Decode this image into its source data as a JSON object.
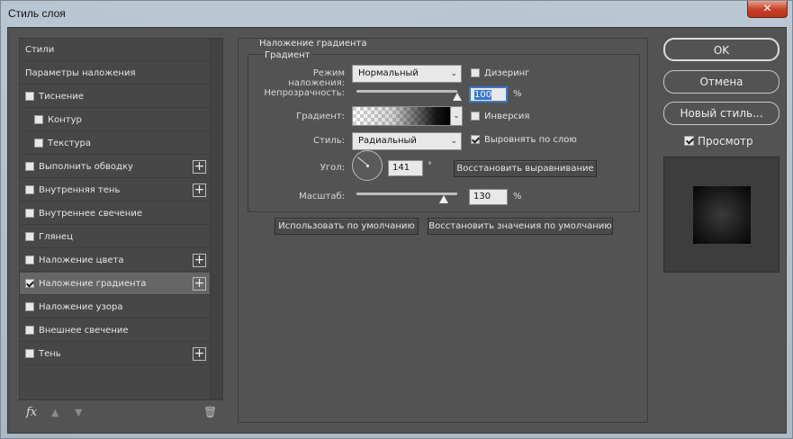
{
  "window": {
    "title": "Стиль слоя",
    "close_label": "✕"
  },
  "sidebar": {
    "items": [
      {
        "label": "Стили",
        "checkbox": false,
        "checked": false,
        "plus": false,
        "indent": 0,
        "selected": false
      },
      {
        "label": "Параметры наложения",
        "checkbox": false,
        "checked": false,
        "plus": false,
        "indent": 0,
        "selected": false
      },
      {
        "label": "Тиснение",
        "checkbox": true,
        "checked": false,
        "plus": false,
        "indent": 0,
        "selected": false
      },
      {
        "label": "Контур",
        "checkbox": true,
        "checked": false,
        "plus": false,
        "indent": 1,
        "selected": false
      },
      {
        "label": "Текстура",
        "checkbox": true,
        "checked": false,
        "plus": false,
        "indent": 1,
        "selected": false
      },
      {
        "label": "Выполнить обводку",
        "checkbox": true,
        "checked": false,
        "plus": true,
        "indent": 0,
        "selected": false
      },
      {
        "label": "Внутренняя тень",
        "checkbox": true,
        "checked": false,
        "plus": true,
        "indent": 0,
        "selected": false
      },
      {
        "label": "Внутреннее свечение",
        "checkbox": true,
        "checked": false,
        "plus": false,
        "indent": 0,
        "selected": false
      },
      {
        "label": "Глянец",
        "checkbox": true,
        "checked": false,
        "plus": false,
        "indent": 0,
        "selected": false
      },
      {
        "label": "Наложение цвета",
        "checkbox": true,
        "checked": false,
        "plus": true,
        "indent": 0,
        "selected": false
      },
      {
        "label": "Наложение градиента",
        "checkbox": true,
        "checked": true,
        "plus": true,
        "indent": 0,
        "selected": true
      },
      {
        "label": "Наложение узора",
        "checkbox": true,
        "checked": false,
        "plus": false,
        "indent": 0,
        "selected": false
      },
      {
        "label": "Внешнее свечение",
        "checkbox": true,
        "checked": false,
        "plus": false,
        "indent": 0,
        "selected": false
      },
      {
        "label": "Тень",
        "checkbox": true,
        "checked": false,
        "plus": true,
        "indent": 0,
        "selected": false
      }
    ],
    "footer": {
      "fx_label": "fx",
      "up_icon": "▲",
      "down_icon": "▼",
      "trash_icon": "🗑"
    }
  },
  "gradient_overlay": {
    "group_title": "Наложение градиента",
    "sub_title": "Градиент",
    "blend_mode": {
      "label": "Режим наложения:",
      "value": "Нормальный"
    },
    "dither": {
      "label": "Дизеринг",
      "checked": false
    },
    "opacity": {
      "label": "Непрозрачность:",
      "value": "100",
      "unit": "%",
      "level": 1.0
    },
    "gradient": {
      "label": "Градиент:"
    },
    "reverse": {
      "label": "Инверсия",
      "checked": false
    },
    "style": {
      "label": "Стиль:",
      "value": "Радиальный"
    },
    "align": {
      "label": "Выровнять по слою",
      "checked": true
    },
    "angle": {
      "label": "Угол:",
      "value": "141",
      "unit": "°"
    },
    "reset_alignment_label": "Восстановить выравнивание",
    "scale": {
      "label": "Масштаб:",
      "value": "130",
      "unit": "%",
      "level": 0.87
    },
    "make_default_label": "Использовать по умолчанию",
    "reset_default_label": "Восстановить значения по умолчанию"
  },
  "actions": {
    "ok_label": "OK",
    "cancel_label": "Отмена",
    "new_style_label": "Новый стиль...",
    "preview": {
      "label": "Просмотр",
      "checked": true
    }
  }
}
